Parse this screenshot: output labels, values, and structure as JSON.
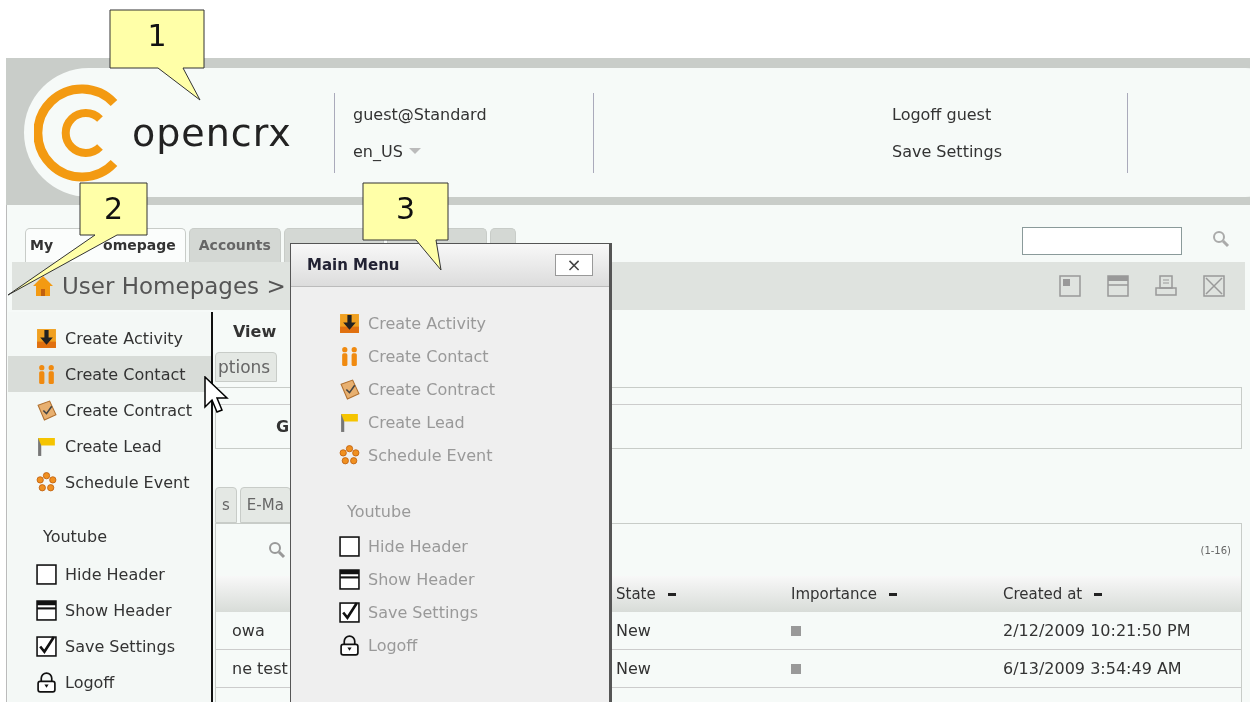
{
  "header": {
    "logo_text": "opencrx",
    "user": "guest@Standard",
    "locale": "en_US",
    "links": [
      "Logoff guest",
      "Save Settings"
    ]
  },
  "tabs": [
    {
      "label_parts": [
        "My",
        "omepage"
      ],
      "selected": true
    },
    {
      "label_parts": [
        "Accounts"
      ],
      "selected": false
    }
  ],
  "breadcrumb": "User Homepages >",
  "content": {
    "view_label": "View",
    "subtab": "ptions",
    "grid_letter": "G",
    "lower_tabs": [
      "s",
      "E-Ma"
    ],
    "count": "(1-16)",
    "columns": [
      "State",
      "Importance",
      "Created at"
    ],
    "rows": [
      {
        "name": "owa",
        "state": "New",
        "created": "2/12/2009 10:21:50 PM"
      },
      {
        "name": "ne test",
        "state": "New",
        "created": "6/13/2009 3:54:49 AM"
      }
    ]
  },
  "left_menu": {
    "items": [
      {
        "kind": "activity",
        "label": "Create Activity",
        "selected": false,
        "disabled": false
      },
      {
        "kind": "contact",
        "label": "Create Contact",
        "selected": true,
        "disabled": false
      },
      {
        "kind": "contract",
        "label": "Create Contract",
        "selected": false,
        "disabled": false
      },
      {
        "kind": "lead",
        "label": "Create Lead",
        "selected": false,
        "disabled": false
      },
      {
        "kind": "event",
        "label": "Schedule Event",
        "selected": false,
        "disabled": false
      },
      {
        "kind": "heading",
        "label": "Youtube",
        "selected": false,
        "disabled": false
      },
      {
        "kind": "hide-header",
        "label": "Hide Header",
        "selected": false,
        "disabled": false
      },
      {
        "kind": "show-header",
        "label": "Show Header",
        "selected": false,
        "disabled": false
      },
      {
        "kind": "save-settings",
        "label": "Save Settings",
        "selected": false,
        "disabled": false
      },
      {
        "kind": "logoff",
        "label": "Logoff",
        "selected": false,
        "disabled": false
      }
    ]
  },
  "main_menu": {
    "title": "Main Menu",
    "close": "×",
    "items": [
      {
        "kind": "activity",
        "label": "Create Activity",
        "disabled": true
      },
      {
        "kind": "contact",
        "label": "Create Contact",
        "disabled": true
      },
      {
        "kind": "contract",
        "label": "Create Contract",
        "disabled": true
      },
      {
        "kind": "lead",
        "label": "Create Lead",
        "disabled": true
      },
      {
        "kind": "event",
        "label": "Schedule Event",
        "disabled": true
      },
      {
        "kind": "heading",
        "label": "Youtube",
        "disabled": true
      },
      {
        "kind": "hide-header",
        "label": "Hide Header",
        "disabled": true
      },
      {
        "kind": "show-header",
        "label": "Show Header",
        "disabled": true
      },
      {
        "kind": "save-settings",
        "label": "Save Settings",
        "disabled": true
      },
      {
        "kind": "logoff",
        "label": "Logoff",
        "disabled": true
      }
    ]
  },
  "callouts": [
    {
      "number": "1"
    },
    {
      "number": "2"
    },
    {
      "number": "3"
    }
  ]
}
